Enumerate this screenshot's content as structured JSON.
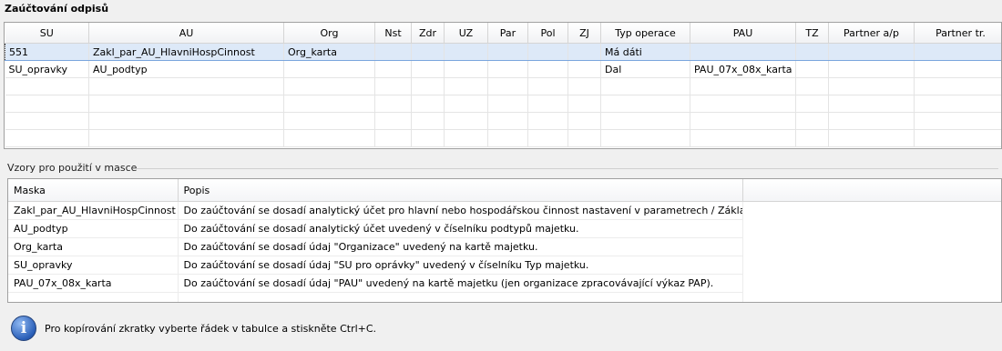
{
  "title": "Zaúčtování odpisů",
  "top_grid": {
    "columns": [
      "SU",
      "AU",
      "Org",
      "Nst",
      "Zdr",
      "UZ",
      "Par",
      "Pol",
      "ZJ",
      "Typ operace",
      "PAU",
      "TZ",
      "Partner a/p",
      "Partner tr."
    ],
    "rows": [
      [
        "551",
        "Zakl_par_AU_HlavniHospCinnost",
        "Org_karta",
        "",
        "",
        "",
        "",
        "",
        "",
        "Má dáti",
        "",
        "",
        "",
        ""
      ],
      [
        "SU_opravky",
        "AU_podtyp",
        "",
        "",
        "",
        "",
        "",
        "",
        "",
        "Dal",
        "PAU_07x_08x_karta",
        "",
        "",
        ""
      ]
    ]
  },
  "group_label": "Vzory pro použití v masce",
  "bottom_grid": {
    "columns": [
      "Maska",
      "Popis"
    ],
    "rows": [
      [
        "Zakl_par_AU_HlavniHospCinnost",
        "Do zaúčtování se dosadí analytický účet pro hlavní nebo hospodářskou činnost nastavení v parametrech / Základní."
      ],
      [
        "AU_podtyp",
        "Do zaúčtování se dosadí analytický účet uvedený v číselníku podtypů majetku."
      ],
      [
        "Org_karta",
        "Do zaúčtování se dosadí údaj \"Organizace\" uvedený na kartě majetku."
      ],
      [
        "SU_opravky",
        "Do zaúčtování se dosadí údaj \"SU pro oprávky\" uvedený v číselníku Typ majetku."
      ],
      [
        "PAU_07x_08x_karta",
        "Do zaúčtování se dosadí údaj \"PAU\" uvedený na kartě majetku (jen organizace zpracovávající výkaz PAP)."
      ]
    ]
  },
  "info": {
    "icon": "info-icon",
    "text": "Pro kopírování zkratky vyberte řádek v tabulce a stiskněte Ctrl+C."
  }
}
